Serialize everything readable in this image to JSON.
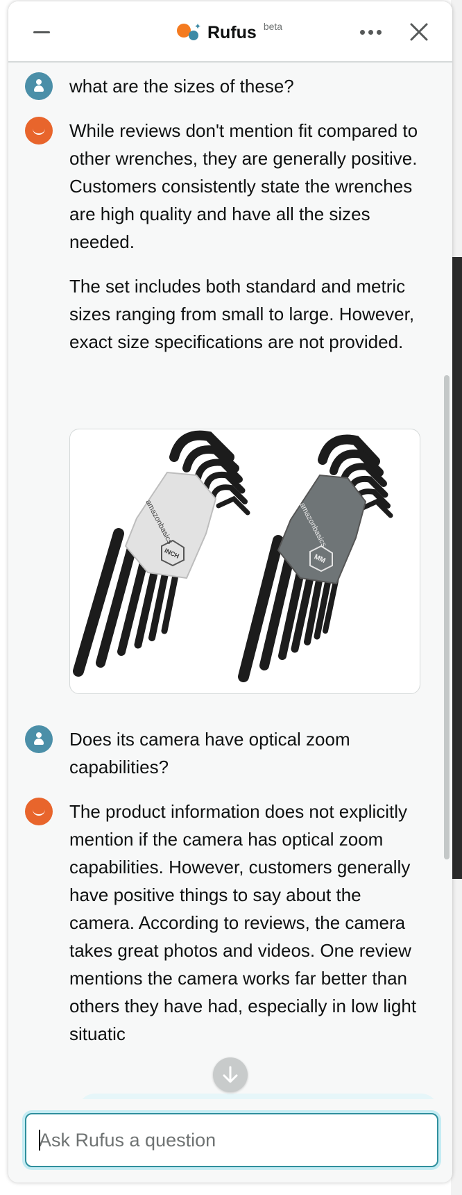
{
  "header": {
    "title": "Rufus",
    "badge": "beta",
    "minimize_icon": "minimize-icon",
    "more_icon": "more-options-icon",
    "close_icon": "close-icon"
  },
  "messages": [
    {
      "role": "user",
      "text": [
        "what are the sizes of these?"
      ]
    },
    {
      "role": "assistant",
      "text": [
        "While reviews don't mention fit compared to other wrenches, they are generally positive. Customers consistently state the wrenches are high quality and have all the sizes needed.",
        "The set includes both standard and metric sizes ranging from small to large. However, exact size specifications are not provided."
      ],
      "image": {
        "left_case_label": "INCH",
        "right_case_label": "MM",
        "brand": "amazonbasics"
      }
    },
    {
      "role": "user",
      "text": [
        "Does its camera have optical zoom capabilities?"
      ]
    },
    {
      "role": "assistant",
      "text": [
        "The product information does not explicitly mention if the camera has optical zoom capabilities. However, customers generally have positive things to say about the camera. According to reviews, the camera takes great photos and videos. One review mentions the camera works far better than others they have had, especially in low light situatic"
      ]
    }
  ],
  "input": {
    "placeholder": "Ask Rufus a question",
    "value": ""
  },
  "colors": {
    "accent": "#2f8f9d",
    "user_avatar": "#4b8fa8",
    "bot_avatar": "#e8652c",
    "logo_orange": "#f47b20"
  }
}
